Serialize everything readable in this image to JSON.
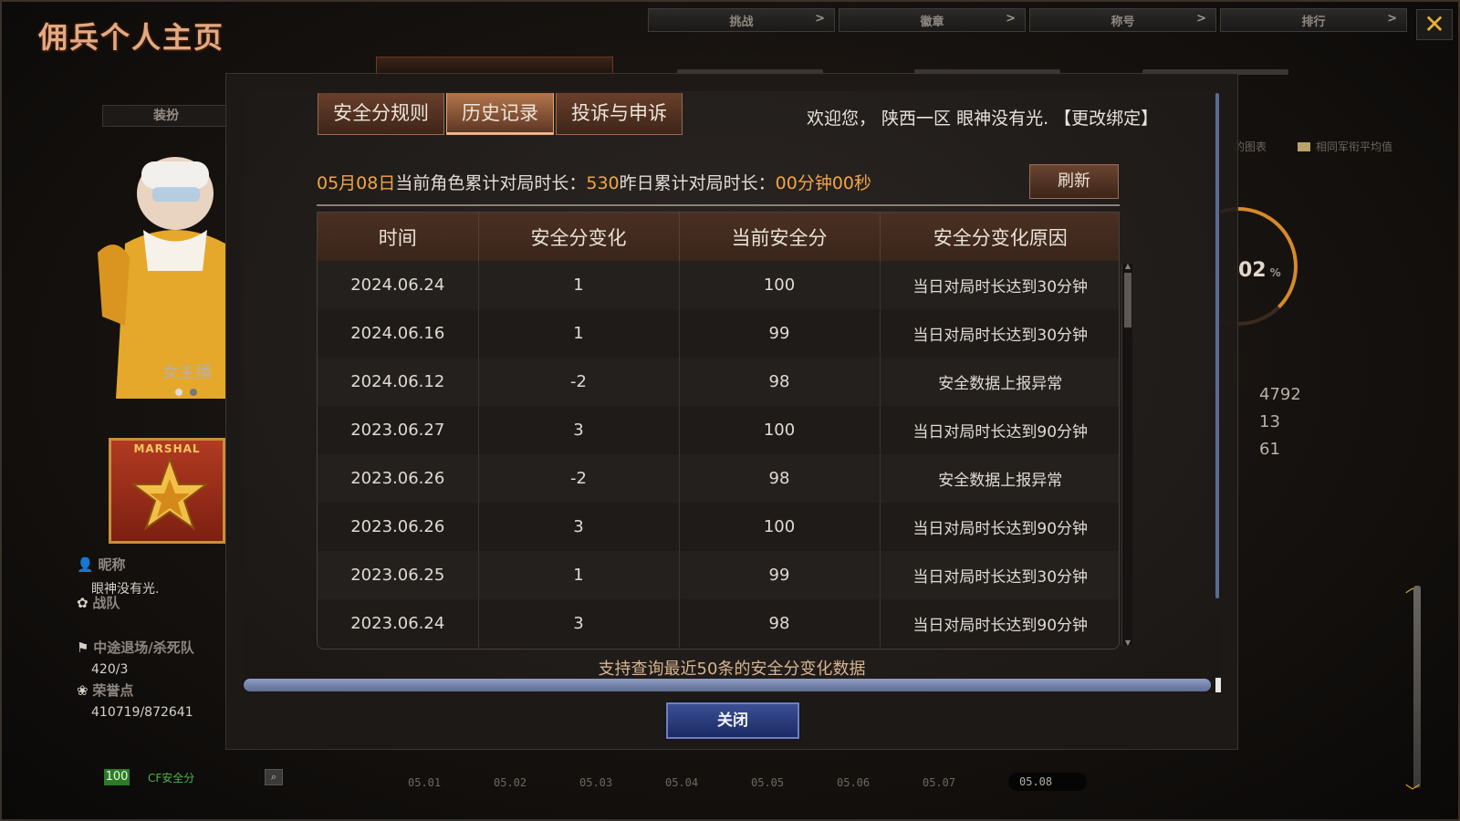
{
  "page": {
    "title": "佣兵个人主页",
    "top_tabs": [
      "挑战",
      "徽章",
      "称号",
      "排行"
    ],
    "close_icon": "close-icon"
  },
  "sidebar": {
    "dress_label": "装扮",
    "avatar_caption": "女主播",
    "rank_text": "MARSHAL",
    "nickname_label": "昵称",
    "nickname_value": "眼神没有光.",
    "team_label": "战队",
    "quit_label": "中途退场/杀死队",
    "quit_value": "420/3",
    "honor_label": "荣誉点",
    "honor_value": "410719/872641"
  },
  "bottom": {
    "score": "100",
    "cf_label": "CF安全分",
    "search_icon": "search-icon",
    "dates": [
      "05.01",
      "05.02",
      "05.03",
      "05.04",
      "05.05",
      "05.06",
      "05.07",
      "05.08"
    ]
  },
  "right_panel": {
    "legend_a": "的图表",
    "legend_b": "相同军衔平均值",
    "gauge_value": "02",
    "gauge_unit": "%",
    "stats": [
      "4792",
      "13",
      "61"
    ]
  },
  "modal": {
    "tabs": [
      "安全分规则",
      "历史记录",
      "投诉与申诉"
    ],
    "active_tab": 1,
    "welcome": "欢迎您， 陕西一区 眼神没有光. 【更改绑定】",
    "stats_date": "05月08日",
    "stats_label1": "当前角色累计对局时长：",
    "stats_value1": "530",
    "stats_label2": "昨日累计对局时长：",
    "stats_value2": "00分钟00秒",
    "refresh_label": "刷新",
    "table": {
      "headers": [
        "时间",
        "安全分变化",
        "当前安全分",
        "安全分变化原因"
      ],
      "rows": [
        [
          "2024.06.24",
          "1",
          "100",
          "当日对局时长达到30分钟"
        ],
        [
          "2024.06.16",
          "1",
          "99",
          "当日对局时长达到30分钟"
        ],
        [
          "2024.06.12",
          "-2",
          "98",
          "安全数据上报异常"
        ],
        [
          "2023.06.27",
          "3",
          "100",
          "当日对局时长达到90分钟"
        ],
        [
          "2023.06.26",
          "-2",
          "98",
          "安全数据上报异常"
        ],
        [
          "2023.06.26",
          "3",
          "100",
          "当日对局时长达到90分钟"
        ],
        [
          "2023.06.25",
          "1",
          "99",
          "当日对局时长达到30分钟"
        ],
        [
          "2023.06.24",
          "3",
          "98",
          "当日对局时长达到90分钟"
        ]
      ]
    },
    "note": "支持查询最近50条的安全分变化数据",
    "close_label": "关闭"
  },
  "colors": {
    "accent_orange": "#f1a547",
    "tab_active": "#b4764c",
    "close_button": "#3a4f93",
    "title": "#e2a982"
  }
}
